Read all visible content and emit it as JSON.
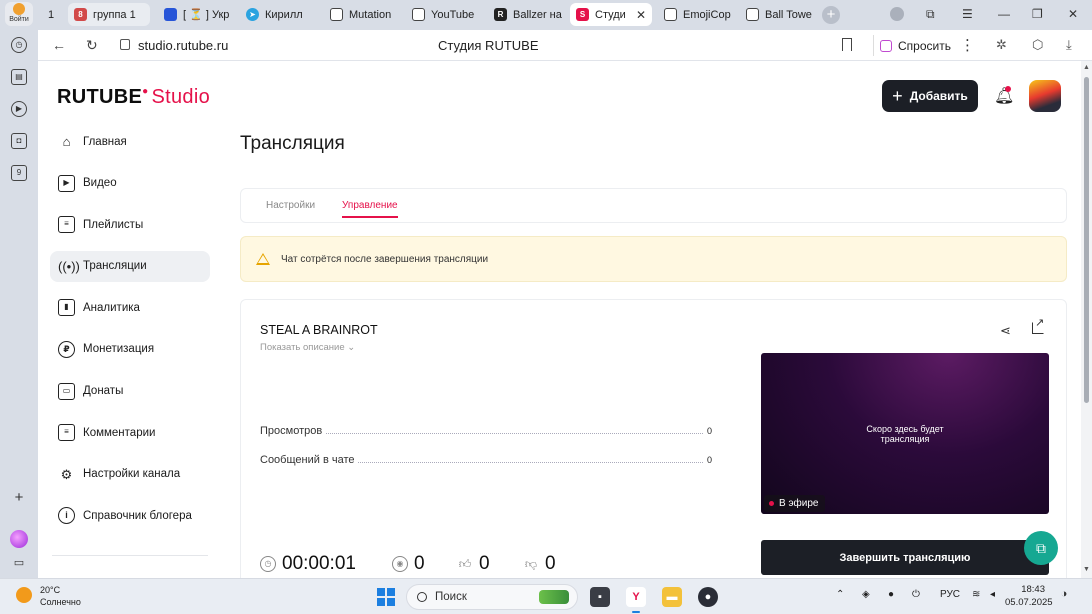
{
  "browser": {
    "login_label": "Войти",
    "tabs": [
      {
        "label": "1",
        "favicon": "tab-counter",
        "color": "#4a4a4a"
      },
      {
        "label": "группа 1",
        "favicon": "group",
        "color": "#d24a4a",
        "badge": "8"
      },
      {
        "label": "[ ⏳ ] Укр",
        "favicon": "vk",
        "color": "#2755d8"
      },
      {
        "label": "Кирилл",
        "favicon": "telegram",
        "color": "#2aa3e0"
      },
      {
        "label": "Mutation",
        "favicon": "doc",
        "color": "#444"
      },
      {
        "label": "YouTube",
        "favicon": "doc",
        "color": "#444"
      },
      {
        "label": "Ballzer на",
        "favicon": "r-logo",
        "color": "#222"
      },
      {
        "label": "Студи",
        "favicon": "rutube",
        "color": "#e5114a",
        "active": true
      },
      {
        "label": "EmojiCop",
        "favicon": "doc",
        "color": "#444"
      },
      {
        "label": "Ball Towe",
        "favicon": "doc",
        "color": "#444"
      }
    ],
    "url": "studio.rutube.ru",
    "page_title": "Студия RUTUBE",
    "ask_label": "Спросить"
  },
  "header": {
    "logo_main": "RUTUBE",
    "logo_studio": "Studio",
    "add_label": "Добавить"
  },
  "sidebar": {
    "items": [
      {
        "label": "Главная",
        "icon": "home-icon"
      },
      {
        "label": "Видео",
        "icon": "video-icon"
      },
      {
        "label": "Плейлисты",
        "icon": "playlist-icon"
      },
      {
        "label": "Трансляции",
        "icon": "broadcast-icon",
        "active": true
      },
      {
        "label": "Аналитика",
        "icon": "analytics-icon"
      },
      {
        "label": "Монетизация",
        "icon": "ruble-icon"
      },
      {
        "label": "Донаты",
        "icon": "wallet-icon"
      },
      {
        "label": "Комментарии",
        "icon": "comment-icon"
      },
      {
        "label": "Настройки канала",
        "icon": "gear-icon"
      },
      {
        "label": "Справочник блогера",
        "icon": "info-icon"
      }
    ]
  },
  "main": {
    "title": "Трансляция",
    "tabs": [
      {
        "label": "Настройки"
      },
      {
        "label": "Управление",
        "active": true
      }
    ],
    "warning": "Чат сотрётся после завершения трансляции",
    "stream": {
      "name": "STEAL A BRAINROT",
      "show_description": "Показать описание",
      "stats": [
        {
          "label": "Просмотров",
          "value": "0"
        },
        {
          "label": "Сообщений в чате",
          "value": "0"
        }
      ],
      "preview_text_1": "Скоро здесь будет",
      "preview_text_2": "трансляция",
      "live_label": "В эфире",
      "end_label": "Завершить трансляцию",
      "timer": "00:00:01",
      "viewers": "0",
      "likes": "0",
      "dislikes": "0"
    }
  },
  "taskbar": {
    "temp": "20°C",
    "weather": "Солнечно",
    "search": "Поиск",
    "lang": "РУС",
    "time": "18:43",
    "date": "05.07.2025"
  },
  "colors": {
    "accent": "#e5114a",
    "dark": "#1c1f26",
    "warning_bg": "#fff8e1"
  }
}
